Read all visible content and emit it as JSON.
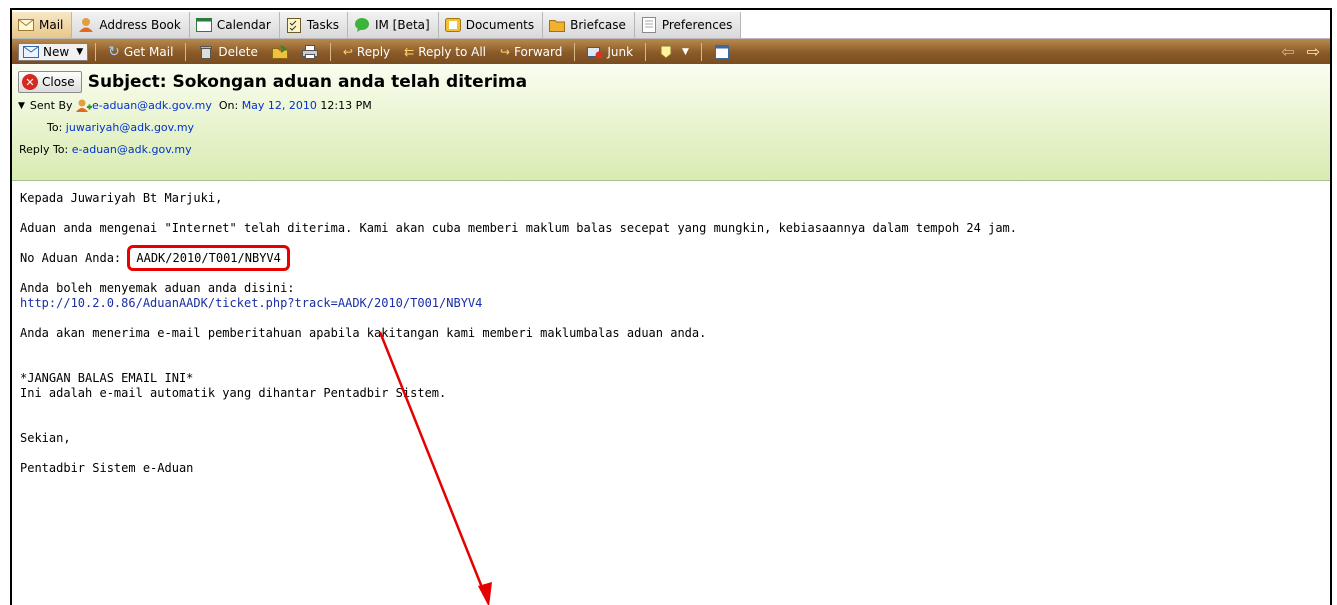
{
  "app_tabs": [
    {
      "label": "Mail",
      "icon": "mail-icon",
      "active": true
    },
    {
      "label": "Address Book",
      "icon": "address-book-icon"
    },
    {
      "label": "Calendar",
      "icon": "calendar-icon"
    },
    {
      "label": "Tasks",
      "icon": "tasks-icon"
    },
    {
      "label": "IM [Beta]",
      "icon": "chat-bubble-icon"
    },
    {
      "label": "Documents",
      "icon": "documents-icon"
    },
    {
      "label": "Briefcase",
      "icon": "briefcase-icon"
    },
    {
      "label": "Preferences",
      "icon": "preferences-icon"
    }
  ],
  "toolbar": {
    "new": "New",
    "get_mail": "Get Mail",
    "delete": "Delete",
    "reply": "Reply",
    "reply_all": "Reply to All",
    "forward": "Forward",
    "junk": "Junk"
  },
  "header": {
    "close": "Close",
    "subject": "Subject: Sokongan aduan anda telah diterima",
    "sent_by_label": "Sent By",
    "sender": "e-aduan@adk.gov.my",
    "on_label": "On:",
    "date": "May 12, 2010",
    "time": "12:13 PM",
    "to_label": "To:",
    "to": "juwariyah@adk.gov.my",
    "reply_to_label": "Reply To:",
    "reply_to": "e-aduan@adk.gov.my"
  },
  "body": {
    "greeting": "Kepada Juwariyah Bt Marjuki,",
    "para1": "Aduan anda mengenai \"Internet\" telah diterima. Kami akan cuba memberi maklum balas secepat yang mungkin, kebiasaannya dalam tempoh 24 jam.",
    "no_label": "No Aduan Anda: ",
    "no_value": "AADK/2010/T001/NBYV4",
    "semak": "Anda boleh menyemak aduan anda disini:",
    "link": "http://10.2.0.86/AduanAADK/ticket.php?track=AADK/2010/T001/NBYV4",
    "para3": "Anda akan menerima e-mail pemberitahuan apabila kakitangan kami memberi maklumbalas aduan anda.",
    "warning": "*JANGAN BALAS EMAIL INI*",
    "auto": "Ini adalah e-mail automatik yang dihantar Pentadbir Sistem.",
    "closing": "Sekian,",
    "sign": "Pentadbir Sistem e-Aduan"
  },
  "colors": {
    "annotation": "#e60000",
    "link": "#1a2ea6",
    "toolbar": "#8a5a28"
  }
}
